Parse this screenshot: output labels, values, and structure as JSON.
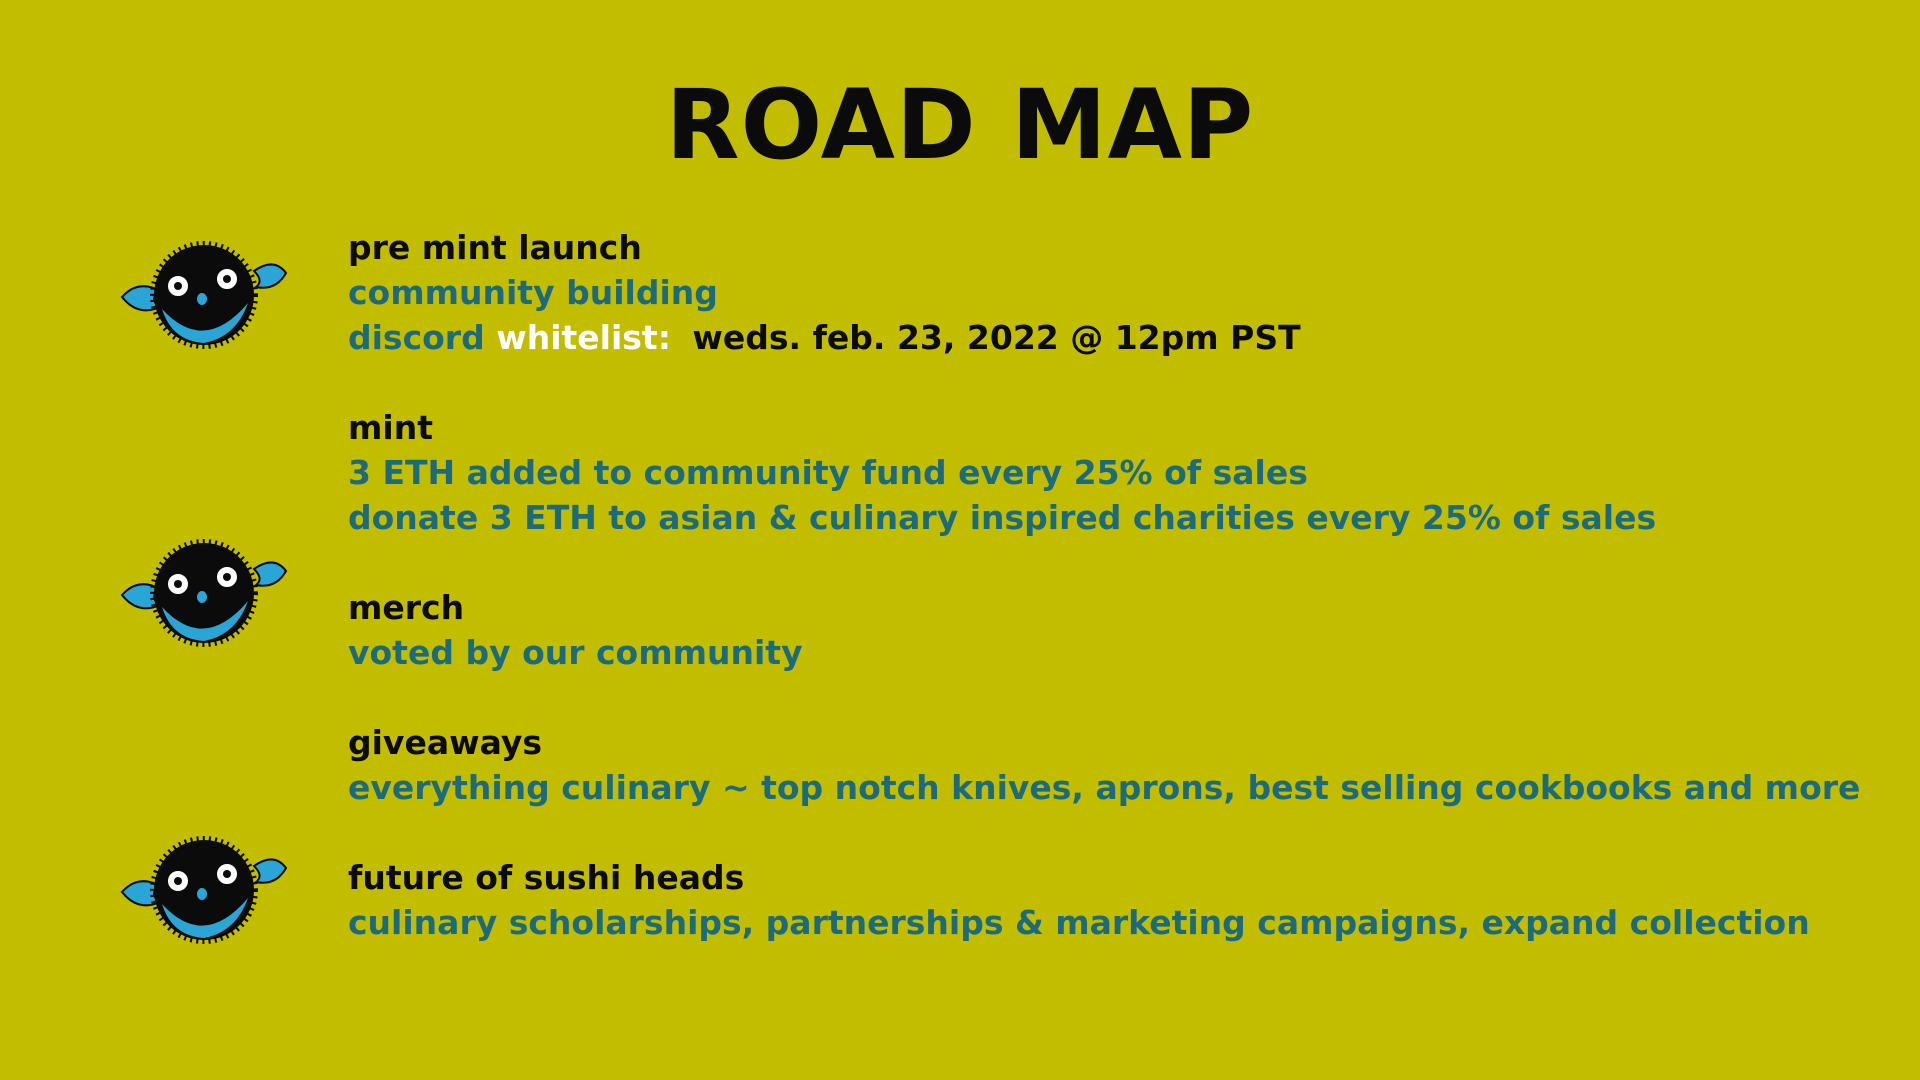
{
  "title": "ROAD MAP",
  "sections": [
    {
      "heading": "pre mint launch",
      "line1": "community building",
      "discord": "discord",
      "whitelist": "whitelist:",
      "date": "weds. feb. 23, 2022 @ 12pm PST"
    },
    {
      "heading": "mint",
      "line1": "3 ETH added to community fund every 25% of sales",
      "line2": "donate 3 ETH to asian & culinary inspired charities every 25% of sales"
    },
    {
      "heading": "merch",
      "line1": "voted by our community"
    },
    {
      "heading": "giveaways",
      "line1": "everything culinary ~ top notch knives, aprons, best selling cookbooks and more"
    },
    {
      "heading": "future of sushi heads",
      "line1": "culinary scholarships, partnerships & marketing campaigns, expand collection"
    }
  ],
  "icons": [
    "pufferfish-icon",
    "pufferfish-icon",
    "pufferfish-icon"
  ],
  "colors": {
    "background": "#c3bd00",
    "heading": "#0b0b0b",
    "detail": "#1c6b7c",
    "highlight": "#ffffff",
    "fish_fin": "#29a6d6"
  }
}
